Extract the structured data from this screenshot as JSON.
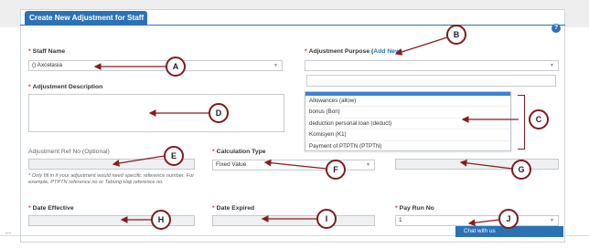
{
  "form": {
    "title": "Create New Adjustment for Staff",
    "help_icon": "?",
    "staff_name": {
      "label": "Staff Name",
      "value": "() Axcelasia"
    },
    "adjustment_purpose": {
      "label": "Adjustment Purpose",
      "link": "Add New",
      "options": [
        "Allowances (allow)",
        "bonus (Bon)",
        "deduction personal loan (deduct)",
        "Komisyen (K1)",
        "Payment of PTPTN (PTPTN)"
      ]
    },
    "adjustment_description": {
      "label": "Adjustment Description"
    },
    "adjustment_ref": {
      "label": "Adjustment Ref No (Optional)",
      "note": "* Only fill in if your adjustment would need specific reference number. For example, PTPTN reference no or Tabung Haji reference no."
    },
    "calculation_type": {
      "label": "Calculation Type",
      "value": "Fixed Value"
    },
    "date_effective": {
      "label": "Date Effective"
    },
    "date_expired": {
      "label": "Date Expired"
    },
    "pay_run_no": {
      "label": "Pay Run No",
      "value": "1"
    },
    "required_mark": "*"
  },
  "annotations": [
    "A",
    "B",
    "C",
    "D",
    "E",
    "F",
    "G",
    "H",
    "I",
    "J"
  ],
  "chat": {
    "label": "Chat with us"
  },
  "colors": {
    "accent": "#2a72b5",
    "annotation": "#8a1c1c",
    "required": "#dd3333"
  }
}
